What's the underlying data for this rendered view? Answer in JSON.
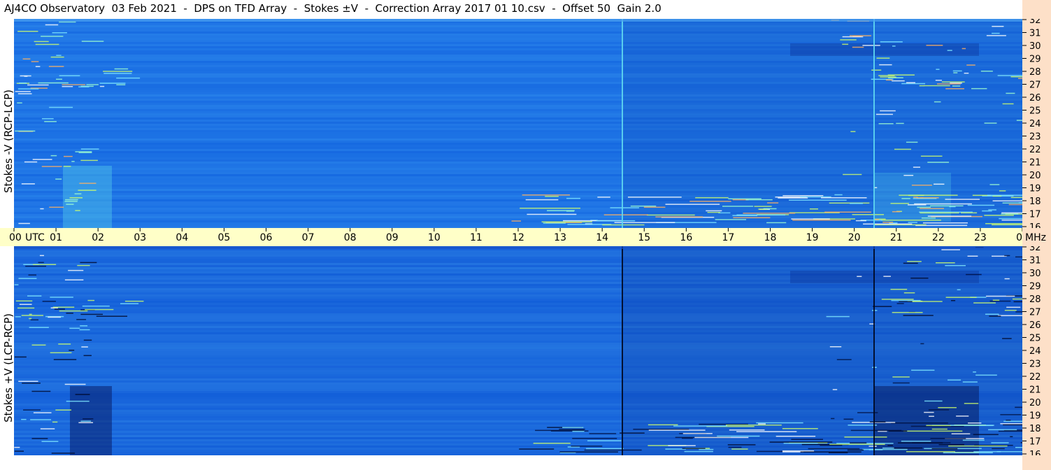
{
  "title": "AJ4CO Observatory  03 Feb 2021  -  DPS on TFD Array  -  Stokes ±V  -  Correction Array 2017 01 10.csv  -  Offset 50  Gain 2.0",
  "chart_data": {
    "type": "heatmap",
    "panels": [
      {
        "name": "top",
        "ylabel": "Stokes -V (RCP-LCP)",
        "y_ticks": [
          "32",
          "31",
          "30",
          "29",
          "28",
          "27",
          "26",
          "25",
          "24",
          "23",
          "22",
          "21",
          "20",
          "19",
          "18",
          "17",
          "16"
        ],
        "ylim": [
          16,
          32
        ]
      },
      {
        "name": "bottom",
        "ylabel": "Stokes +V (LCP-RCP)",
        "y_ticks": [
          "32",
          "31",
          "30",
          "29",
          "28",
          "27",
          "26",
          "25",
          "24",
          "23",
          "22",
          "21",
          "20",
          "19",
          "18",
          "17",
          "16"
        ],
        "ylim": [
          16,
          32
        ]
      }
    ],
    "x_ticks": [
      "00",
      "01",
      "02",
      "03",
      "04",
      "05",
      "06",
      "07",
      "08",
      "09",
      "10",
      "11",
      "12",
      "13",
      "14",
      "15",
      "16",
      "17",
      "18",
      "19",
      "20",
      "21",
      "22",
      "23",
      "00"
    ],
    "x_unit": "UTC",
    "y_unit": "MHz",
    "xlim": [
      0,
      24
    ],
    "colors": {
      "background_top": "#1f78e6",
      "background_bottom": "#1d6fe0",
      "right_strip": "#fde0c8",
      "time_axis": "#ffffc8"
    }
  }
}
